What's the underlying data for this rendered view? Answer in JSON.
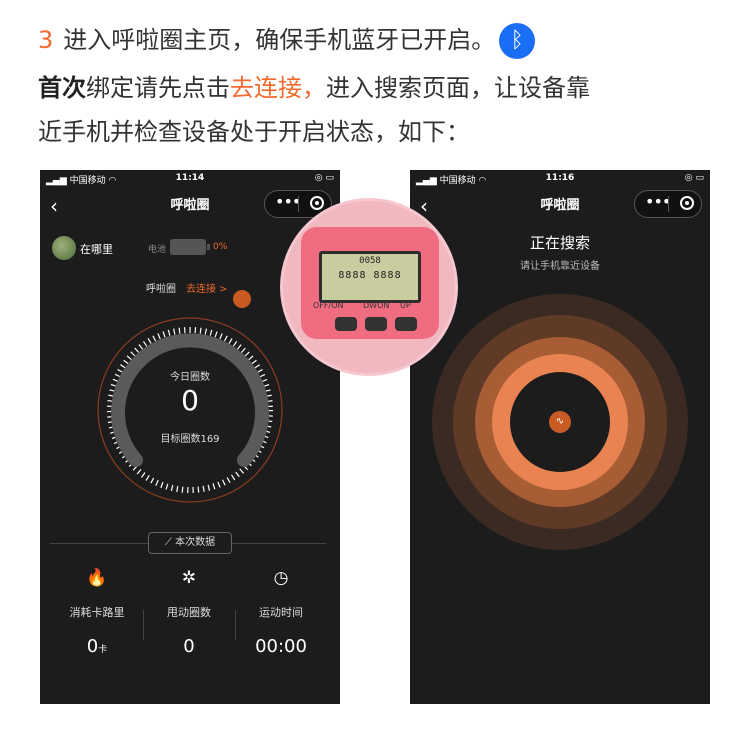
{
  "instructions": {
    "step_number": "3",
    "line1": "进入呼啦圈主页，确保手机蓝牙已开启。",
    "bluetooth_icon": "bluetooth-icon",
    "line2_bold": "首次",
    "line2_a": "绑定请先点击",
    "line2_highlight": "去连接，",
    "line2_b": "进入搜索页面，让设备靠",
    "line3": "近手机并检查设备处于开启状态，如下："
  },
  "phone1": {
    "status": {
      "carrier": "中国移动",
      "time": "11:14",
      "signal_icon": "signal-icon",
      "wifi_icon": "wifi-icon",
      "battery_icon": "battery-icon"
    },
    "title": "呼啦圈",
    "user_name": "在哪里",
    "battery_label": "电池",
    "battery_percent": "0%",
    "device_label": "呼啦圈",
    "connect_link": "去连接 >",
    "gauge": {
      "today_label": "今日圈数",
      "count": "0",
      "target_label": "目标圈数169"
    },
    "this_data": "本次数据",
    "stats": [
      {
        "icon": "flame-icon",
        "label": "消耗卡路里",
        "value": "0",
        "unit": "卡"
      },
      {
        "icon": "hula-person-icon",
        "label": "甩动圈数",
        "value": "0",
        "unit": ""
      },
      {
        "icon": "clock-icon",
        "label": "运动时间",
        "value": "00:00",
        "unit": ""
      }
    ]
  },
  "device_zoom": {
    "lcd_top": "0058",
    "lcd_bottom": "8888 8888",
    "buttons": [
      "OFF/ON",
      "DWON",
      "UP"
    ]
  },
  "phone2": {
    "status": {
      "carrier": "中国移动",
      "time": "11:16"
    },
    "title": "呼啦圈",
    "searching_title": "正在搜索",
    "searching_hint": "请让手机靠近设备"
  },
  "colors": {
    "accent": "#f26a2e",
    "bluetooth": "#1a6ef5",
    "phone_bg": "#1c1c1c"
  }
}
